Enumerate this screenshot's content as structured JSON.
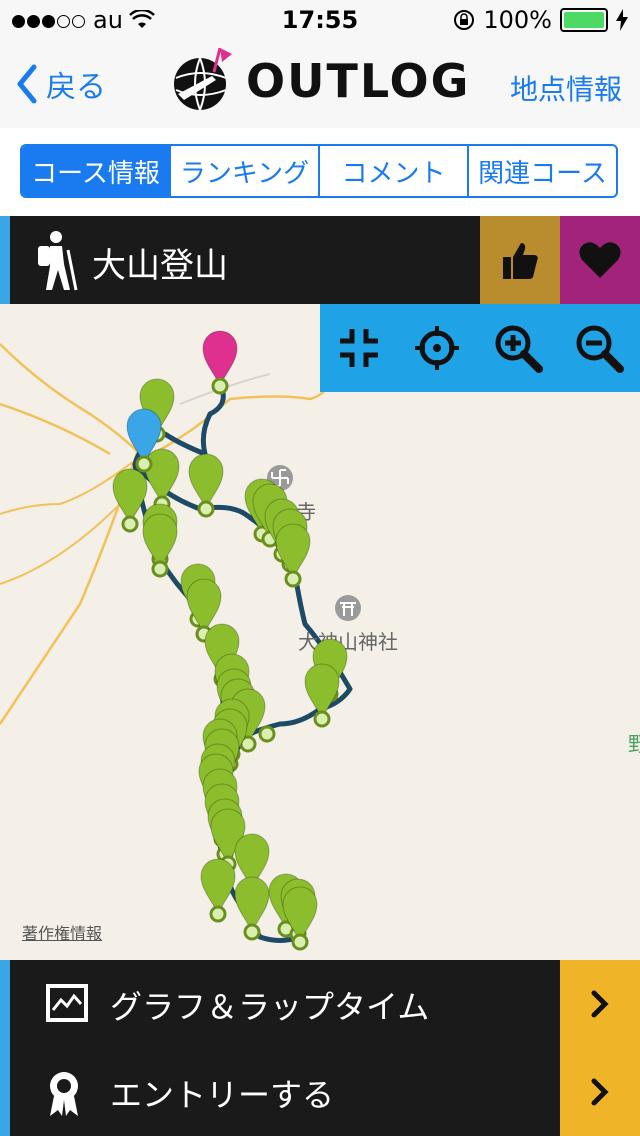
{
  "status": {
    "carrier": "au",
    "time": "17:55",
    "battery": "100%"
  },
  "nav": {
    "back_label": "戻る",
    "logo_text": "OUTLOG",
    "right_label": "地点情報"
  },
  "tabs": [
    {
      "label": "コース情報",
      "active": true
    },
    {
      "label": "ランキング",
      "active": false
    },
    {
      "label": "コメント",
      "active": false
    },
    {
      "label": "関連コース",
      "active": false
    }
  ],
  "course": {
    "title": "大山登山",
    "icon": "hiker-icon"
  },
  "map": {
    "labels": {
      "temple": "寺",
      "shrine": "大神山神社",
      "edge": "野"
    },
    "copyright": "著作権情報",
    "tools": [
      "collapse-icon",
      "locate-icon",
      "zoom-in-icon",
      "zoom-out-icon"
    ]
  },
  "bottom": {
    "graph_label": "グラフ＆ラップタイム",
    "entry_label": "エントリーする"
  },
  "colors": {
    "accent": "#1a7bf0",
    "pin": "#8cbd2c",
    "start_pin": "#e0308f",
    "end_pin": "#3aa6e8",
    "track": "#1e4a66"
  }
}
